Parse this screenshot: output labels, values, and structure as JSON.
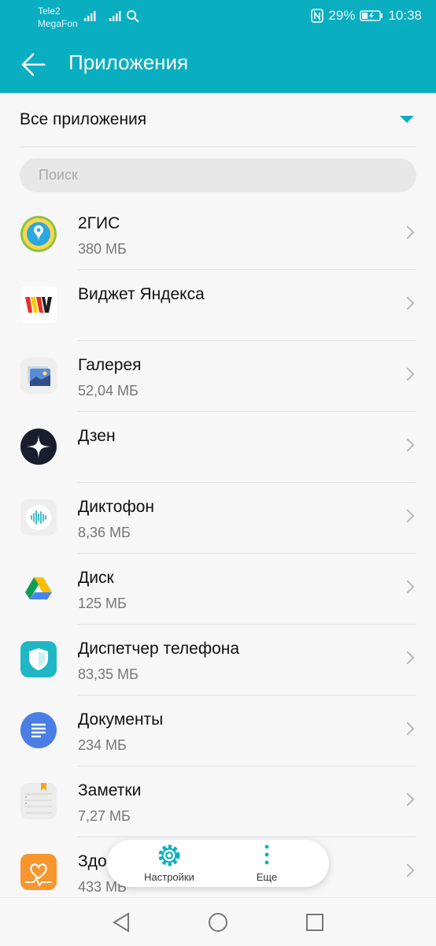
{
  "status_bar": {
    "carrier1": "Tele2",
    "carrier2": "MegaFon",
    "battery": "29%",
    "time": "10:38"
  },
  "header": {
    "title": "Приложения"
  },
  "filter": {
    "label": "Все приложения"
  },
  "search": {
    "placeholder": "Поиск"
  },
  "apps": [
    {
      "name": "2ГИС",
      "size": "380 МБ",
      "icon": "2gis-icon"
    },
    {
      "name": "Виджет Яндекса",
      "size": "",
      "icon": "yandex-widget-icon"
    },
    {
      "name": "Галерея",
      "size": "52,04 МБ",
      "icon": "gallery-icon"
    },
    {
      "name": "Дзен",
      "size": "",
      "icon": "zen-icon"
    },
    {
      "name": "Диктофон",
      "size": "8,36 МБ",
      "icon": "recorder-icon"
    },
    {
      "name": "Диск",
      "size": "125 МБ",
      "icon": "google-drive-icon"
    },
    {
      "name": "Диспетчер телефона",
      "size": "83,35 МБ",
      "icon": "phone-manager-icon"
    },
    {
      "name": "Документы",
      "size": "234 МБ",
      "icon": "docs-icon"
    },
    {
      "name": "Заметки",
      "size": "7,27 МБ",
      "icon": "notes-icon"
    },
    {
      "name": "Здоровье",
      "size": "433 МБ",
      "icon": "health-icon"
    }
  ],
  "bottom_menu": {
    "settings_label": "Настройки",
    "more_label": "Еще"
  },
  "colors": {
    "accent": "#0aaec1"
  }
}
